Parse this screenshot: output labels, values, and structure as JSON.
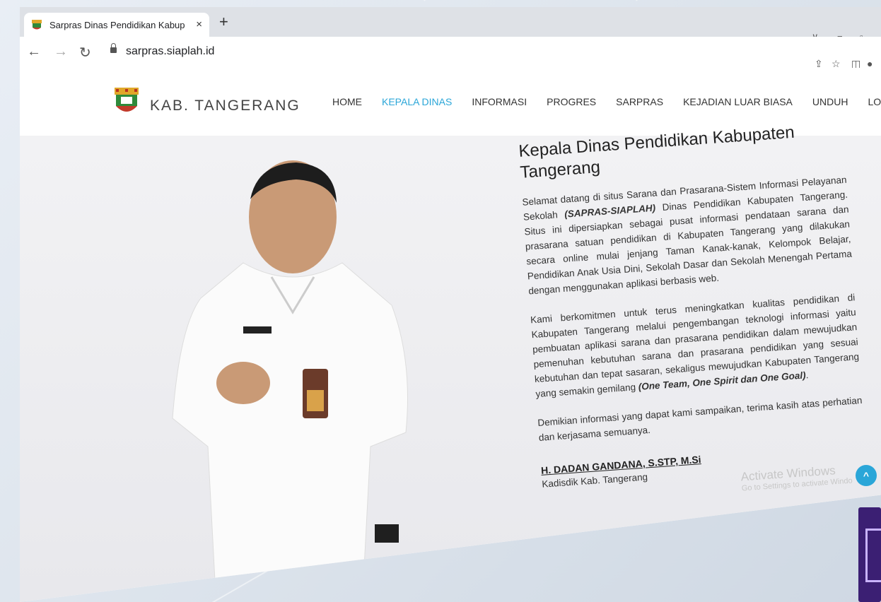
{
  "browser": {
    "tab_title": "Sarpras Dinas Pendidikan Kabup",
    "tab_close": "×",
    "new_tab": "+",
    "url": "sarpras.siaplah.id",
    "win_chevron": "∨",
    "win_minimize": "−",
    "win_restore": "▫"
  },
  "site": {
    "brand": "KAB. TANGERANG",
    "menu": [
      "HOME",
      "KEPALA DINAS",
      "INFORMASI",
      "PROGRES",
      "SARPRAS",
      "KEJADIAN LUAR BIASA",
      "UNDUH",
      "LOGIN ⌄"
    ],
    "active_menu": "KEPALA DINAS",
    "accent_color": "#2aa6d8"
  },
  "content": {
    "heading": "Kepala Dinas Pendidikan Kabupaten Tangerang",
    "p1_before": "Selamat datang di situs Sarana dan Prasarana-Sistem Informasi Pelayanan Sekolah ",
    "p1_bold": "(SAPRAS-SIAPLAH)",
    "p1_after": " Dinas Pendidikan Kabupaten Tangerang. Situs ini dipersiapkan sebagai pusat informasi pendataan sarana dan prasarana satuan pendidikan di Kabupaten Tangerang yang dilakukan secara online mulai jenjang Taman Kanak-kanak, Kelompok Belajar, Pendidikan Anak Usia Dini, Sekolah Dasar dan Sekolah Menengah Pertama dengan menggunakan aplikasi berbasis web.",
    "p2_before": "Kami berkomitmen untuk terus meningkatkan kualitas pendidikan di Kabupaten Tangerang melalui pengembangan teknologi informasi yaitu pembuatan aplikasi sarana dan prasarana pendidikan dalam mewujudkan pemenuhan kebutuhan sarana dan prasarana pendidikan yang sesuai kebutuhan dan tepat sasaran, sekaligus mewujudkan Kabupaten Tangerang yang semakin gemilang ",
    "p2_bold": "(One Team, One Spirit dan One Goal)",
    "p2_after": ".",
    "p3": "Demikian informasi yang dapat kami sampaikan, terima kasih atas perhatian dan kerjasama semuanya.",
    "signer_name": "H. DADAN GANDANA, S.STP, M.Si",
    "signer_title": "Kadisdik Kab. Tangerang"
  },
  "watermark": {
    "line1": "Activate Windows",
    "line2": "Go to Settings to activate Windo"
  }
}
